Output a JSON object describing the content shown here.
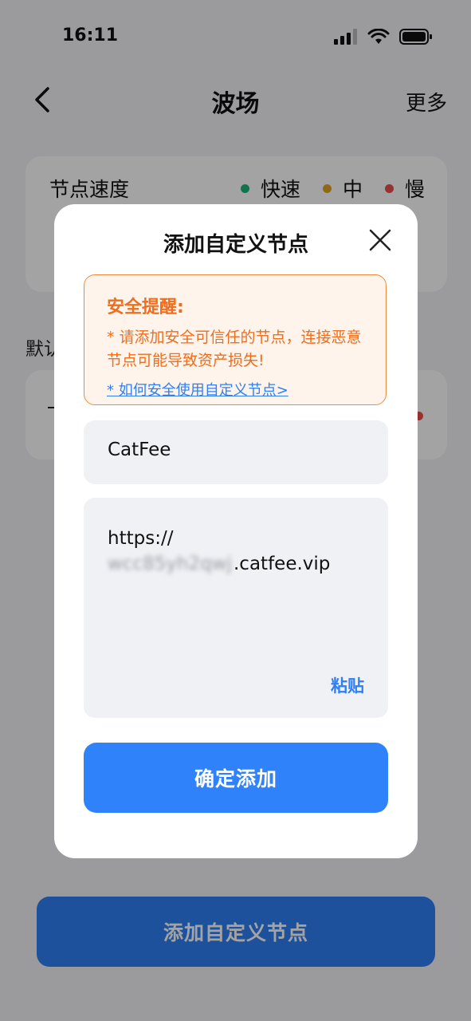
{
  "status": {
    "time": "16:11"
  },
  "nav": {
    "title": "波场",
    "more": "更多"
  },
  "speed_card": {
    "title": "节点速度",
    "legend": [
      {
        "label": "快速",
        "color": "#1fb57a"
      },
      {
        "label": "中",
        "color": "#e5a51d"
      },
      {
        "label": "慢",
        "color": "#ef4b4b"
      }
    ]
  },
  "default_label": "默认",
  "bottom_button": "添加自定义节点",
  "modal": {
    "title": "添加自定义节点",
    "warning": {
      "title": "安全提醒:",
      "text": "* 请添加安全可信任的节点，连接恶意节点可能导致资产损失!",
      "link": "* 如何安全使用自定义节点>"
    },
    "name_value": "CatFee",
    "url_line1": "https://",
    "url_blurred": "wcc85yh2qwj",
    "url_suffix": ".catfee.vip",
    "paste_label": "粘贴",
    "confirm_label": "确定添加"
  },
  "colors": {
    "accent": "#2f7ff3",
    "warning": "#ef6d1c"
  }
}
